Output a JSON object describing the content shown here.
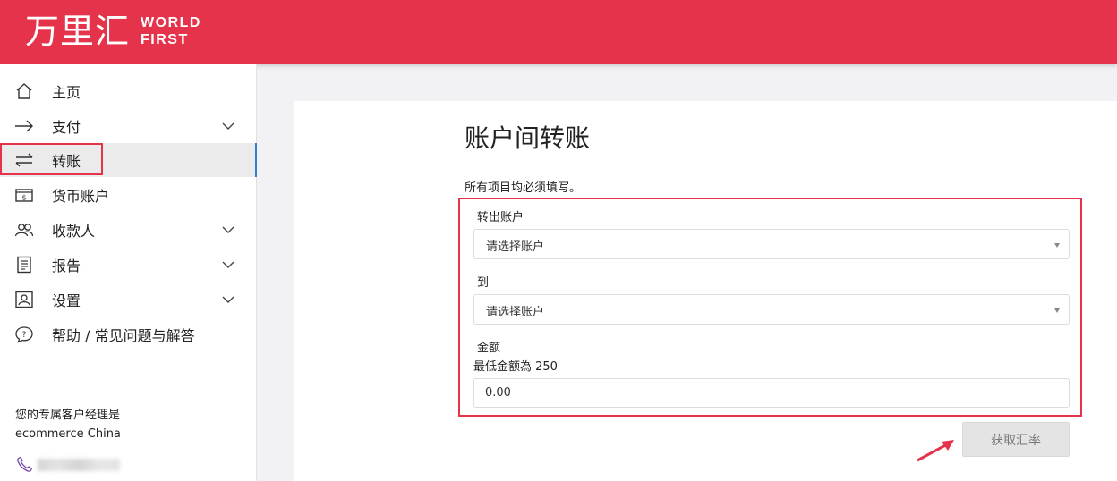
{
  "brand": {
    "logo_cn": "万里汇",
    "logo_en_line1": "WORLD",
    "logo_en_line2": "FIRST",
    "header_color": "#e5334b"
  },
  "sidebar": {
    "items": [
      {
        "label": "主页",
        "icon": "home-icon",
        "has_chevron": false
      },
      {
        "label": "支付",
        "icon": "arrow-right-icon",
        "has_chevron": true
      },
      {
        "label": "转账",
        "icon": "transfer-icon",
        "has_chevron": false,
        "active": true
      },
      {
        "label": "货币账户",
        "icon": "wallet-icon",
        "has_chevron": false
      },
      {
        "label": "收款人",
        "icon": "people-icon",
        "has_chevron": true
      },
      {
        "label": "报告",
        "icon": "report-icon",
        "has_chevron": true
      },
      {
        "label": "设置",
        "icon": "settings-icon",
        "has_chevron": true
      },
      {
        "label": "帮助 / 常见问题与解答",
        "icon": "help-icon",
        "has_chevron": false
      }
    ],
    "manager": {
      "title": "您的专属客户经理是",
      "name": "ecommerce China"
    }
  },
  "main": {
    "title": "账户间转账",
    "required_note": "所有项目均必须填写。",
    "form": {
      "from_label": "转出账户",
      "from_placeholder": "请选择账户",
      "to_label": "到",
      "to_placeholder": "请选择账户",
      "amount_label": "金额",
      "amount_hint": "最低金额為 250",
      "amount_value": "0.00"
    },
    "get_rate_button": "获取汇率"
  },
  "colors": {
    "accent_red": "#e5334b",
    "active_indicator": "#2f7fd8"
  }
}
